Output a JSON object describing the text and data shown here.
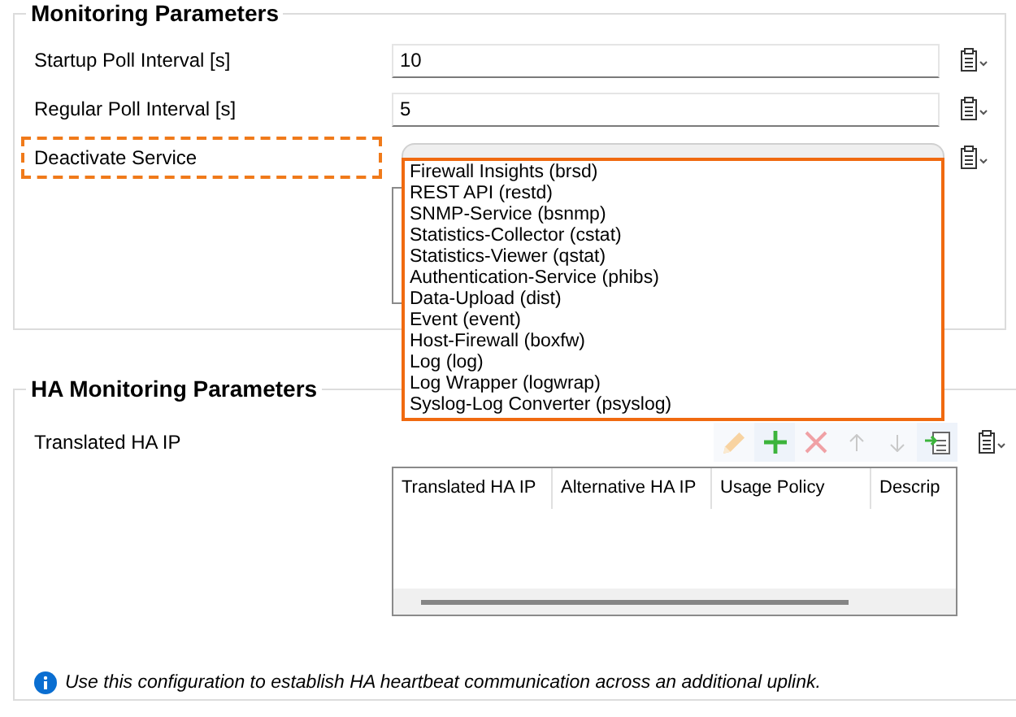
{
  "monitoring": {
    "title": "Monitoring Parameters",
    "rows": [
      {
        "kind": "text",
        "label": "Startup Poll Interval [s]",
        "value": "10",
        "focused": false
      },
      {
        "kind": "text",
        "label": "Regular Poll Interval [s]",
        "value": "5",
        "focused": false
      },
      {
        "kind": "list",
        "label": "Deactivate Service",
        "focused": true
      }
    ],
    "dropdown": {
      "options": [
        {
          "label": "Firewall Insights (brsd)",
          "selected": false
        },
        {
          "label": "REST API (restd)",
          "selected": false
        },
        {
          "label": "SNMP-Service (bsnmp)",
          "selected": false
        },
        {
          "label": "Statistics-Collector (cstat)",
          "selected": false
        },
        {
          "label": "Statistics-Viewer (qstat)",
          "selected": false
        },
        {
          "label": "Authentication-Service (phibs)",
          "selected": false
        },
        {
          "label": "Data-Upload (dist)",
          "selected": false
        },
        {
          "label": "Event (event)",
          "selected": false
        },
        {
          "label": "Host-Firewall (boxfw)",
          "selected": false
        },
        {
          "label": "Log (log)",
          "selected": false
        },
        {
          "label": "Log Wrapper (logwrap)",
          "selected": false
        },
        {
          "label": "Syslog-Log Converter (psyslog)",
          "selected": false
        }
      ]
    }
  },
  "ha": {
    "title": "HA Monitoring Parameters",
    "label": "Translated HA IP",
    "toolbar": [
      {
        "kind": "edit",
        "disabled": true
      },
      {
        "kind": "add",
        "disabled": false
      },
      {
        "kind": "delete",
        "disabled": true
      },
      {
        "kind": "up",
        "disabled": true
      },
      {
        "kind": "down",
        "disabled": true
      },
      {
        "kind": "import",
        "disabled": false
      }
    ],
    "table": {
      "columns": [
        "Translated HA IP",
        "Alternative HA IP",
        "Usage Policy",
        "Descrip"
      ]
    },
    "info": "Use this configuration to establish HA heartbeat communication across an additional uplink."
  }
}
